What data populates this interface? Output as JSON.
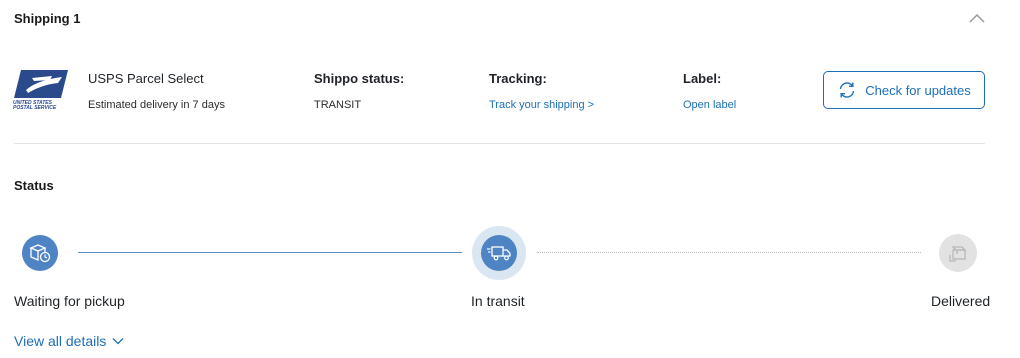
{
  "shipment": {
    "title": "Shipping 1",
    "collapse_icon": "chevron-up-icon"
  },
  "carrier": {
    "logo_icon": "usps-logo",
    "logo_text_line1": "UNITED STATES",
    "logo_text_line2": "POSTAL SERVICE",
    "name": "USPS Parcel Select",
    "eta": "Estimated delivery in 7 days"
  },
  "shippo_status": {
    "label": "Shippo status:",
    "value": "TRANSIT"
  },
  "tracking": {
    "label": "Tracking:",
    "link": "Track your shipping >"
  },
  "label_info": {
    "label": "Label:",
    "link": "Open label"
  },
  "actions": {
    "check_updates": "Check for updates",
    "check_updates_icon": "refresh-icon"
  },
  "status": {
    "title": "Status",
    "current_step": 1,
    "steps": [
      {
        "label": "Waiting for pickup",
        "icon": "package-clock-icon",
        "state": "done"
      },
      {
        "label": "In transit",
        "icon": "delivery-truck-icon",
        "state": "current"
      },
      {
        "label": "Delivered",
        "icon": "package-delivered-icon",
        "state": "pending"
      }
    ]
  },
  "details": {
    "view_all": "View all details",
    "icon": "chevron-down-icon"
  },
  "colors": {
    "accent": "#1d6fb8",
    "step_active": "#4f84c4",
    "step_halo": "#dbe6f3",
    "step_inactive": "#e2e2e2",
    "usps_blue": "#2a4a8c"
  }
}
